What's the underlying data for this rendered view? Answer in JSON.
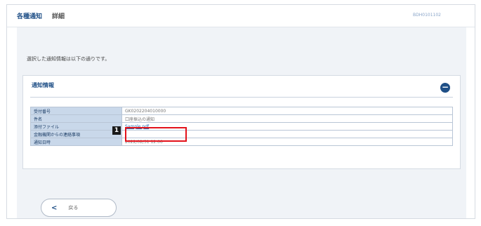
{
  "header": {
    "breadcrumb": [
      "各種通知",
      "詳細"
    ],
    "screen_id": "BDH0101102"
  },
  "intro_text": "選択した通知情報は以下の通りです。",
  "panel": {
    "title": "通知情報",
    "toggle_icon": "−"
  },
  "table": {
    "rows": [
      {
        "label": "受付番号",
        "value": "GK0202204010000"
      },
      {
        "label": "件名",
        "value": "口座振込の通知"
      },
      {
        "label": "添付ファイル",
        "value": "Sample.pdf"
      },
      {
        "label": "金融機関からの連絡事項",
        "value": ""
      },
      {
        "label": "通知日時",
        "value": "2022/02/31 12:00"
      }
    ]
  },
  "annotation": {
    "number": "1"
  },
  "back_button": {
    "icon": "<",
    "label": "戻る"
  }
}
